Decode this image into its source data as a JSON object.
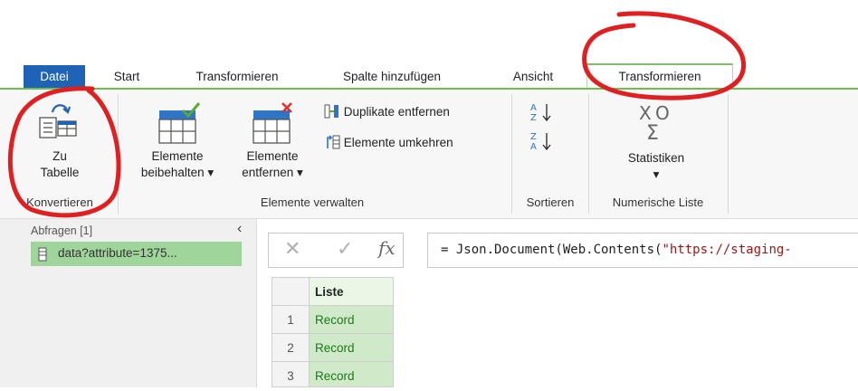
{
  "tabs": [
    {
      "label": "Datei"
    },
    {
      "label": "Start"
    },
    {
      "label": "Transformieren"
    },
    {
      "label": "Spalte hinzufügen"
    },
    {
      "label": "Ansicht"
    },
    {
      "label": "Transformieren"
    }
  ],
  "ribbon": {
    "to_table": {
      "line1": "Zu",
      "line2": "Tabelle"
    },
    "keep_items": {
      "line1": "Elemente",
      "line2": "beibehalten"
    },
    "remove_items": {
      "line1": "Elemente",
      "line2": "entfernen"
    },
    "remove_duplicates": "Duplikate entfernen",
    "reverse_items": "Elemente umkehren",
    "statistics": "Statistiken",
    "groups": {
      "convert": "Konvertieren",
      "manage": "Elemente verwalten",
      "sort": "Sortieren",
      "numeric_list": "Numerische Liste"
    }
  },
  "queries": {
    "header": "Abfragen [1]",
    "items": [
      {
        "label": "data?attribute=1375..."
      }
    ]
  },
  "formula_bar": {
    "prefix": "= Json.Document(Web.Contents(",
    "string": "\"https://staging-"
  },
  "table": {
    "column": "Liste",
    "rows": [
      {
        "num": "1",
        "value": "Record"
      },
      {
        "num": "2",
        "value": "Record"
      },
      {
        "num": "3",
        "value": "Record"
      }
    ]
  },
  "colors": {
    "file_tab": "#1f63b6",
    "accent_green": "#6dbe4b",
    "selected_query": "#9fd49a",
    "record_cell": "#cfe9c9",
    "annotation_red": "#e02020"
  }
}
